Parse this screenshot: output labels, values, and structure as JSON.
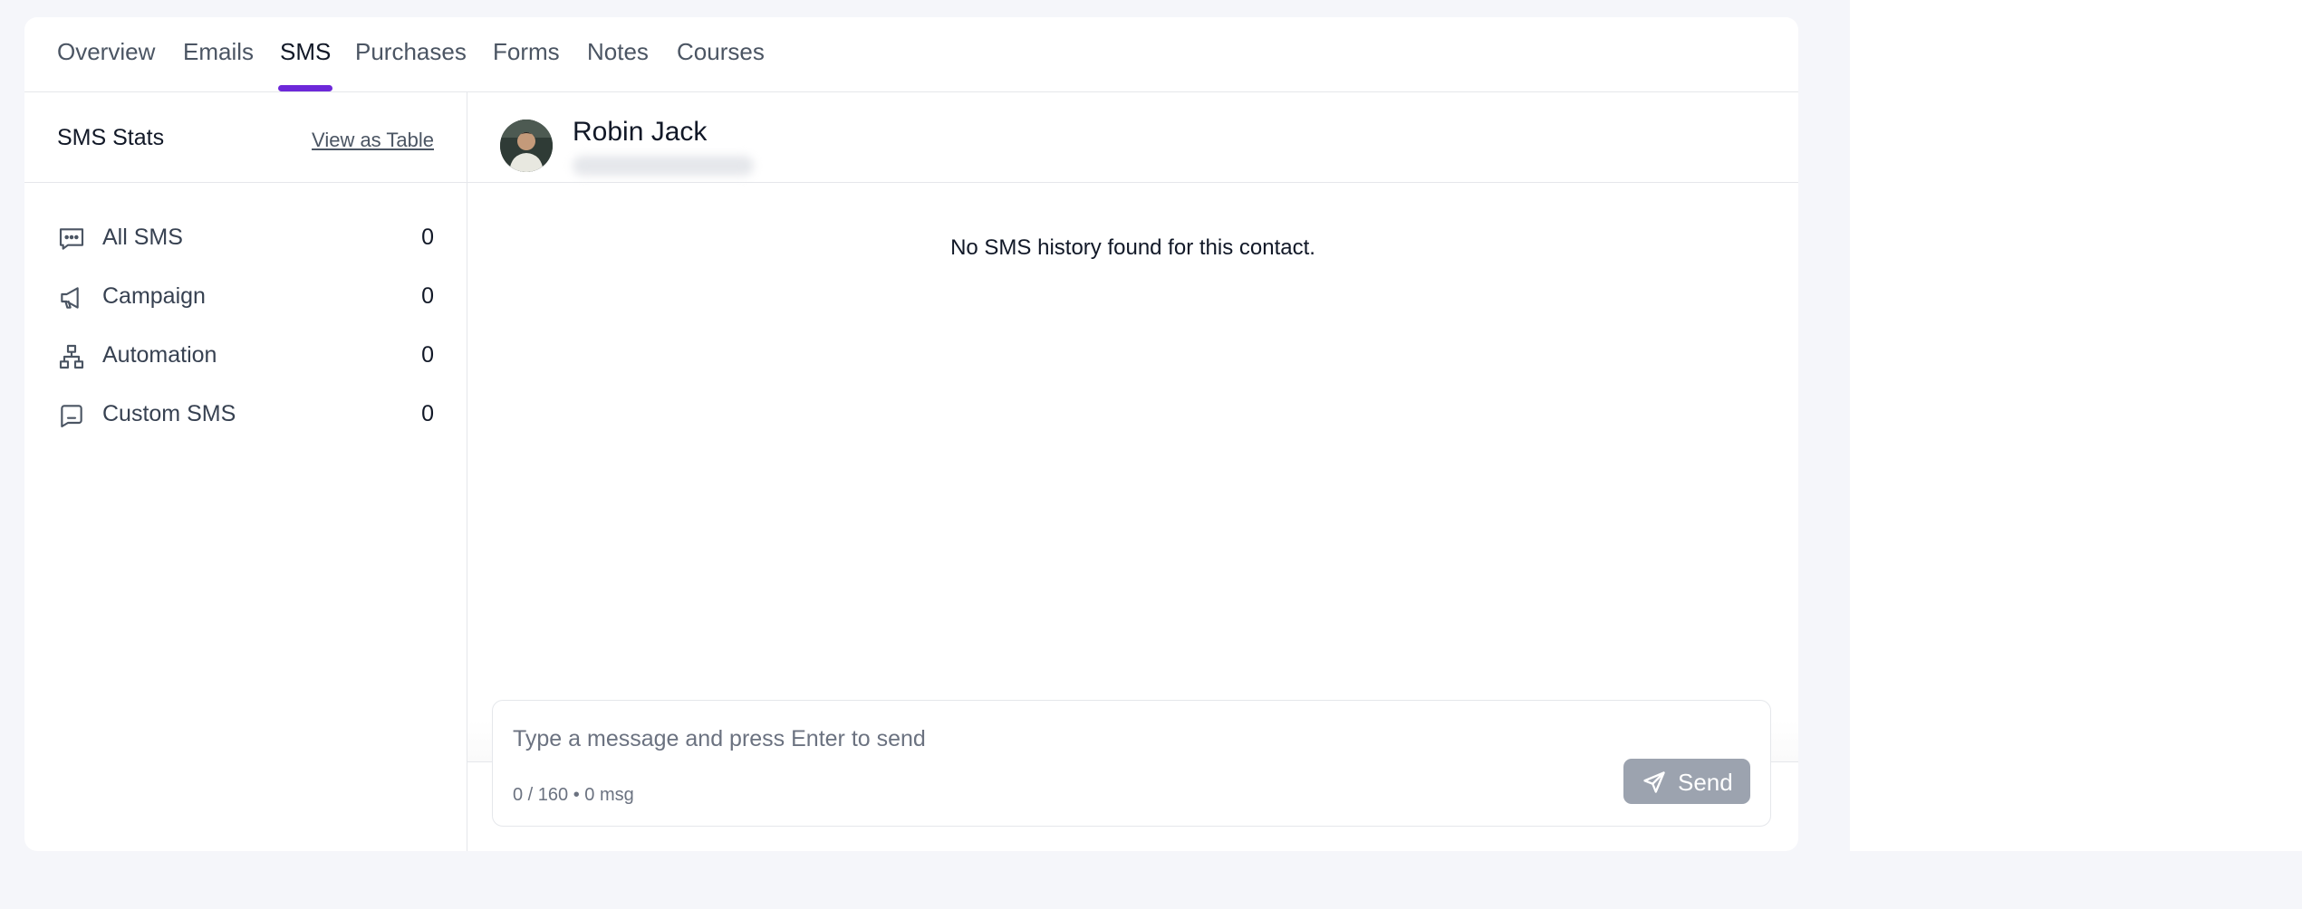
{
  "tabs": [
    {
      "label": "Overview"
    },
    {
      "label": "Emails"
    },
    {
      "label": "SMS",
      "active": true
    },
    {
      "label": "Purchases"
    },
    {
      "label": "Forms"
    },
    {
      "label": "Notes"
    },
    {
      "label": "Courses"
    }
  ],
  "sidebar": {
    "title": "SMS Stats",
    "view_table_label": "View as Table",
    "stats": [
      {
        "label": "All SMS",
        "count": "0",
        "icon": "chat-bubble-icon"
      },
      {
        "label": "Campaign",
        "count": "0",
        "icon": "megaphone-icon"
      },
      {
        "label": "Automation",
        "count": "0",
        "icon": "hierarchy-icon"
      },
      {
        "label": "Custom SMS",
        "count": "0",
        "icon": "message-square-icon"
      }
    ]
  },
  "contact": {
    "name": "Robin Jack"
  },
  "history": {
    "empty_message": "No SMS history found for this contact."
  },
  "composer": {
    "placeholder": "Type a message and press Enter to send",
    "counter": "0 / 160 • 0 msg",
    "send_label": "Send"
  },
  "colors": {
    "accent": "#6d28d9",
    "send_button_disabled": "#9ca3af",
    "page_background": "#f5f6fa"
  }
}
